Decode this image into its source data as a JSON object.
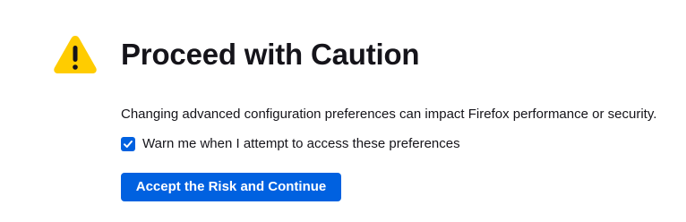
{
  "warning": {
    "icon": "warning-triangle-icon",
    "color": "#ffcc00"
  },
  "title": "Proceed with Caution",
  "description": "Changing advanced configuration preferences can impact Firefox performance or security.",
  "checkbox": {
    "label": "Warn me when I attempt to access these preferences",
    "checked": true,
    "icon": "checkmark-icon"
  },
  "accept_button": {
    "label": "Accept the Risk and Continue"
  },
  "colors": {
    "accent": "#0061e0",
    "text": "#15141a",
    "background": "#ffffff"
  }
}
